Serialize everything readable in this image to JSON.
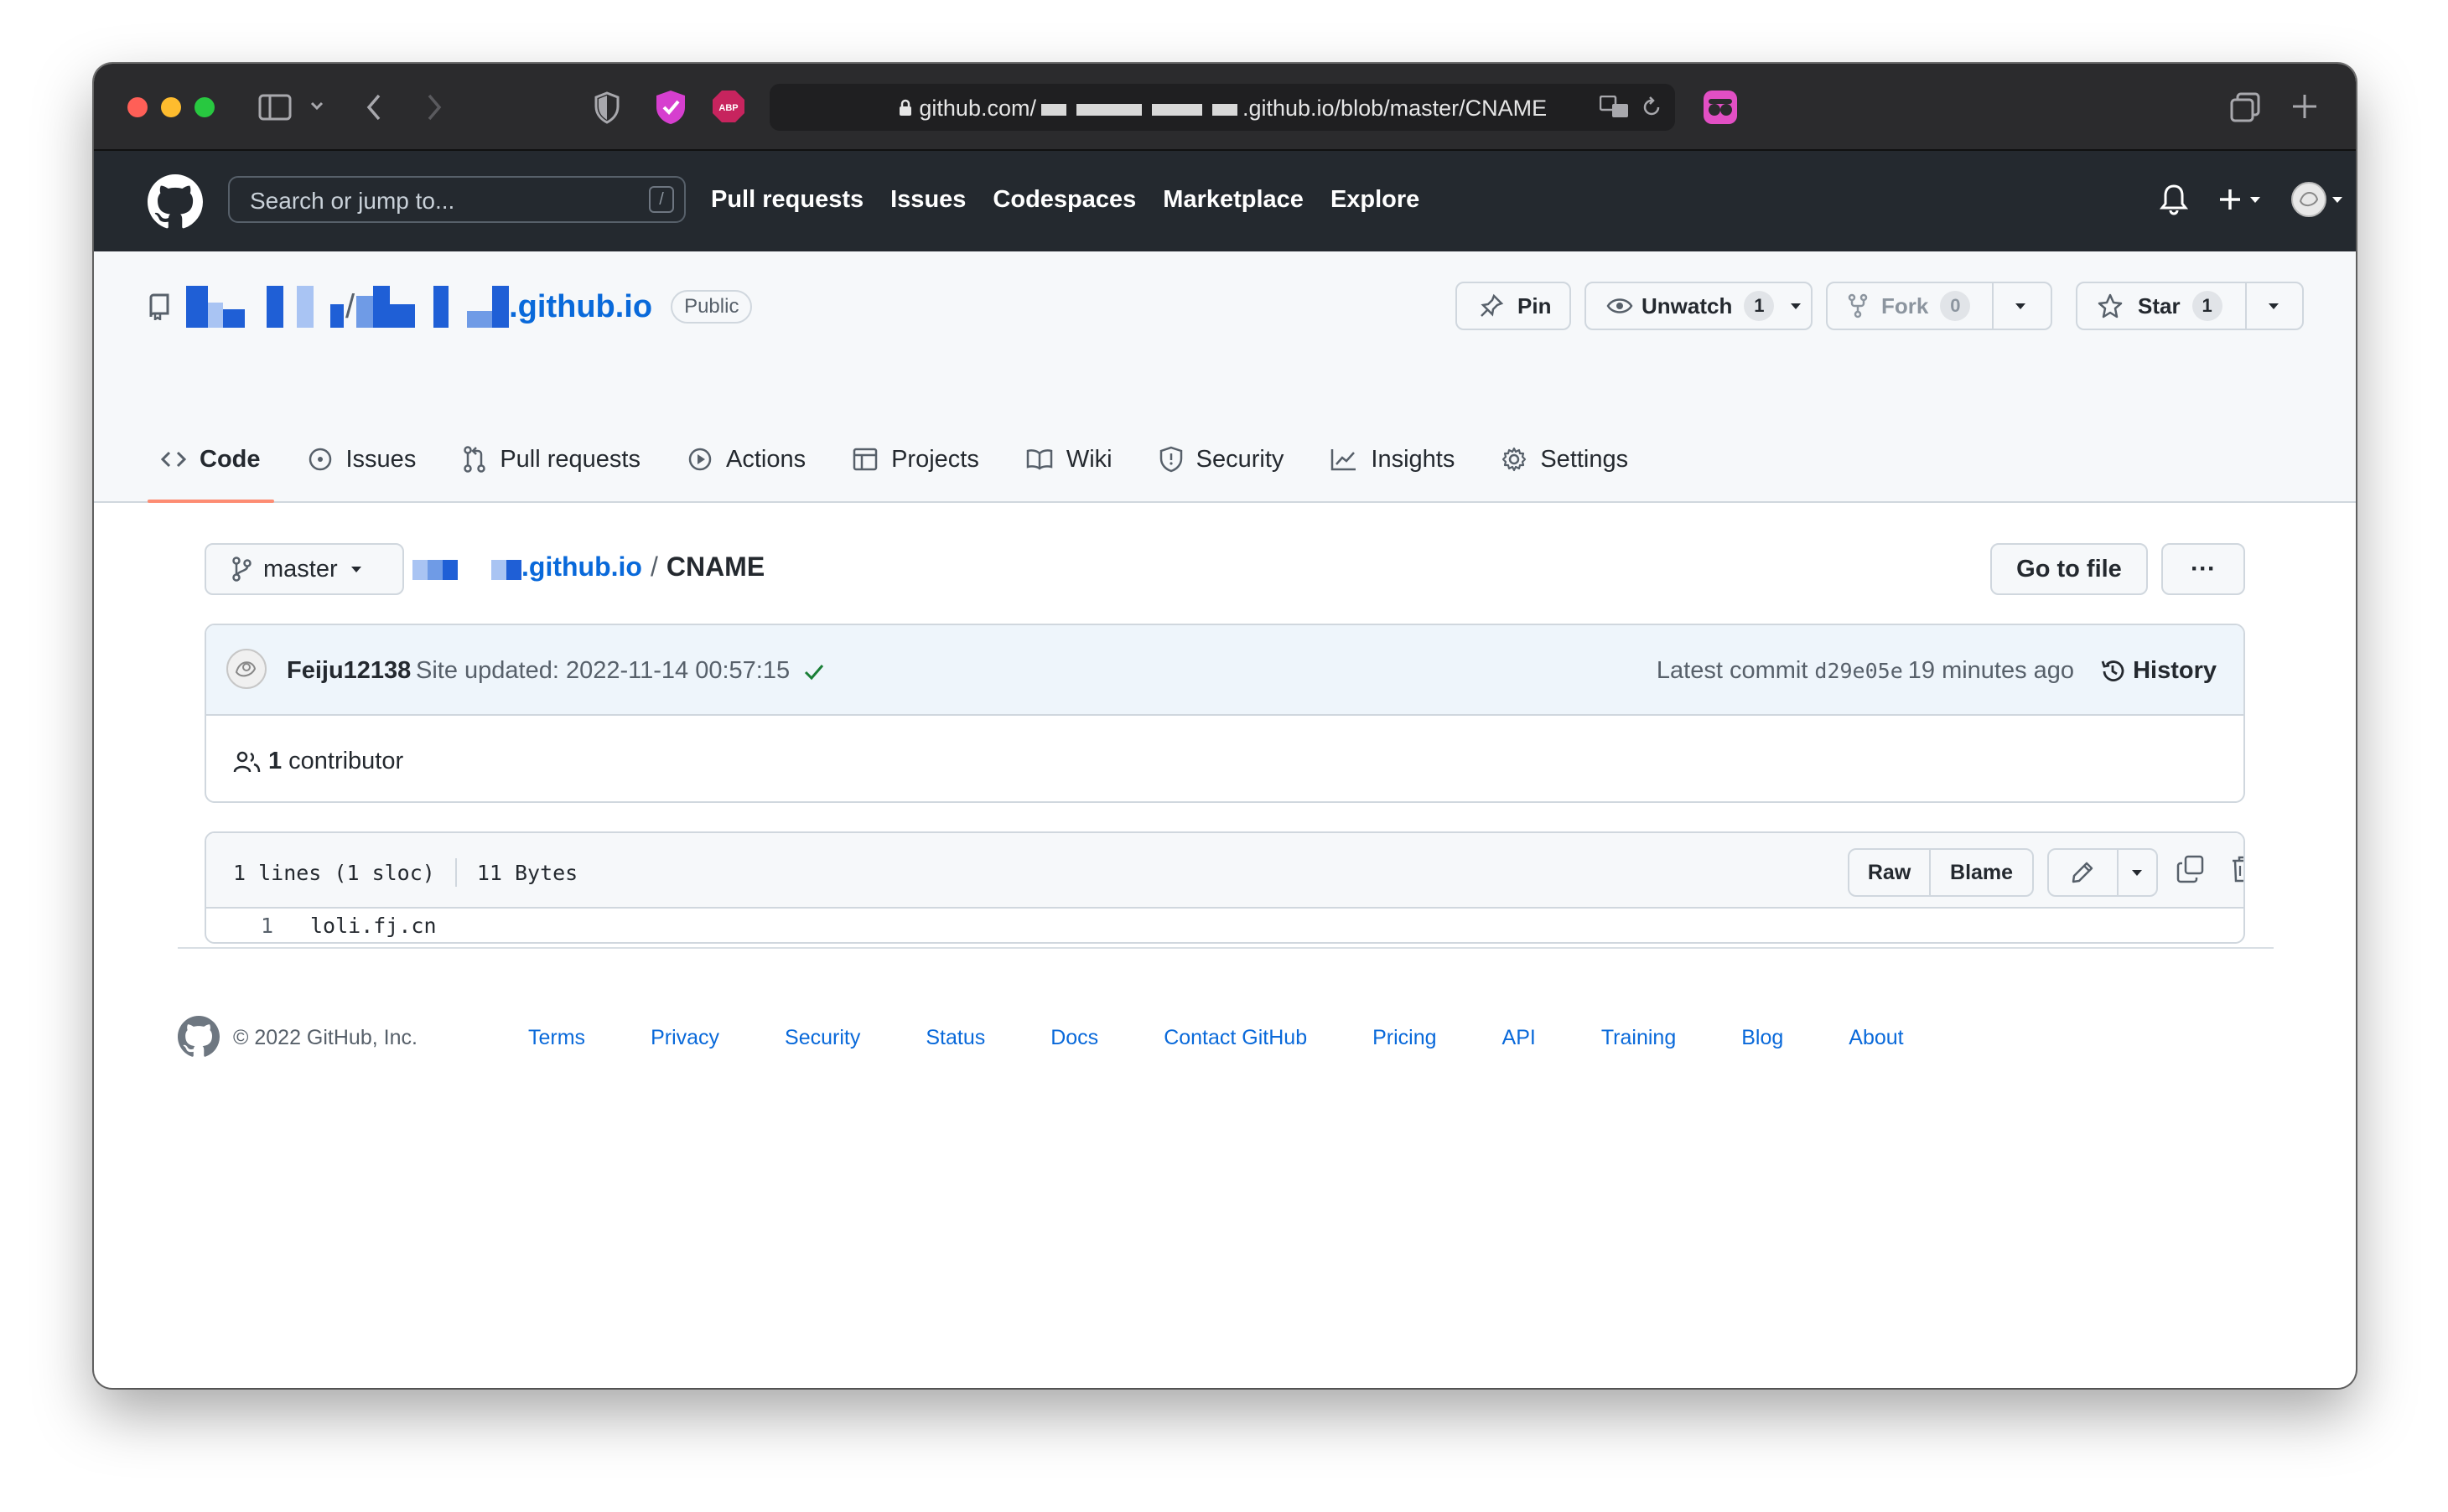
{
  "browser": {
    "url_prefix": "github.com/",
    "url_suffix": ".github.io/blob/master/CNAME"
  },
  "header": {
    "search_placeholder": "Search or jump to...",
    "search_shortcut": "/",
    "nav": [
      "Pull requests",
      "Issues",
      "Codespaces",
      "Marketplace",
      "Explore"
    ]
  },
  "repo": {
    "name_suffix": ".github.io",
    "visibility": "Public",
    "pin_label": "Pin",
    "unwatch_label": "Unwatch",
    "watch_count": "1",
    "fork_label": "Fork",
    "fork_count": "0",
    "star_label": "Star",
    "star_count": "1",
    "tabs": [
      "Code",
      "Issues",
      "Pull requests",
      "Actions",
      "Projects",
      "Wiki",
      "Security",
      "Insights",
      "Settings"
    ]
  },
  "file": {
    "branch": "master",
    "breadcrumb_repo": ".github.io",
    "breadcrumb_sep": "/",
    "filename": "CNAME",
    "goto_label": "Go to file",
    "more_label": "···",
    "commit_author": "Feiju12138",
    "commit_message": "Site updated: 2022-11-14 00:57:15",
    "latest_commit_label": "Latest commit",
    "commit_hash": "d29e05e",
    "commit_time": "19 minutes ago",
    "history_label": "History",
    "contributor_count": "1",
    "contributor_label": "contributor",
    "lines_info": "1 lines (1 sloc)",
    "size_info": "11 Bytes",
    "raw_label": "Raw",
    "blame_label": "Blame",
    "lines": [
      {
        "num": "1",
        "code": "loli.fj.cn"
      }
    ]
  },
  "footer": {
    "copyright": "© 2022 GitHub, Inc.",
    "links": [
      "Terms",
      "Privacy",
      "Security",
      "Status",
      "Docs",
      "Contact GitHub",
      "Pricing",
      "API",
      "Training",
      "Blog",
      "About"
    ]
  },
  "colors": {
    "link": "#0969da",
    "header_bg": "#24292f",
    "tab_underline": "#fd8c73",
    "check": "#1a7f37"
  }
}
